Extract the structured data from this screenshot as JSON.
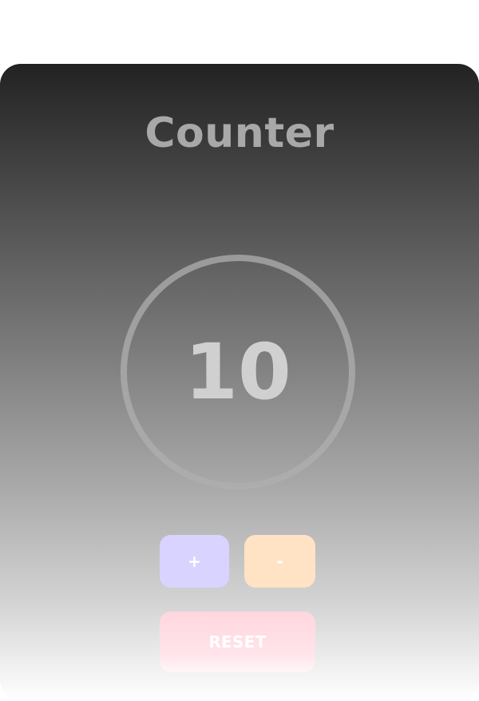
{
  "app": {
    "title": "Counter"
  },
  "counter": {
    "value": "10"
  },
  "controls": {
    "increment_label": "+",
    "decrement_label": "-",
    "reset_label": "RESET"
  },
  "colors": {
    "increment_bg": "#d9d4ff",
    "decrement_bg": "#ffe3c4",
    "reset_bg": "#ffd6de",
    "title_text": "#a8a8a8",
    "count_text": "#d0d0d0"
  }
}
